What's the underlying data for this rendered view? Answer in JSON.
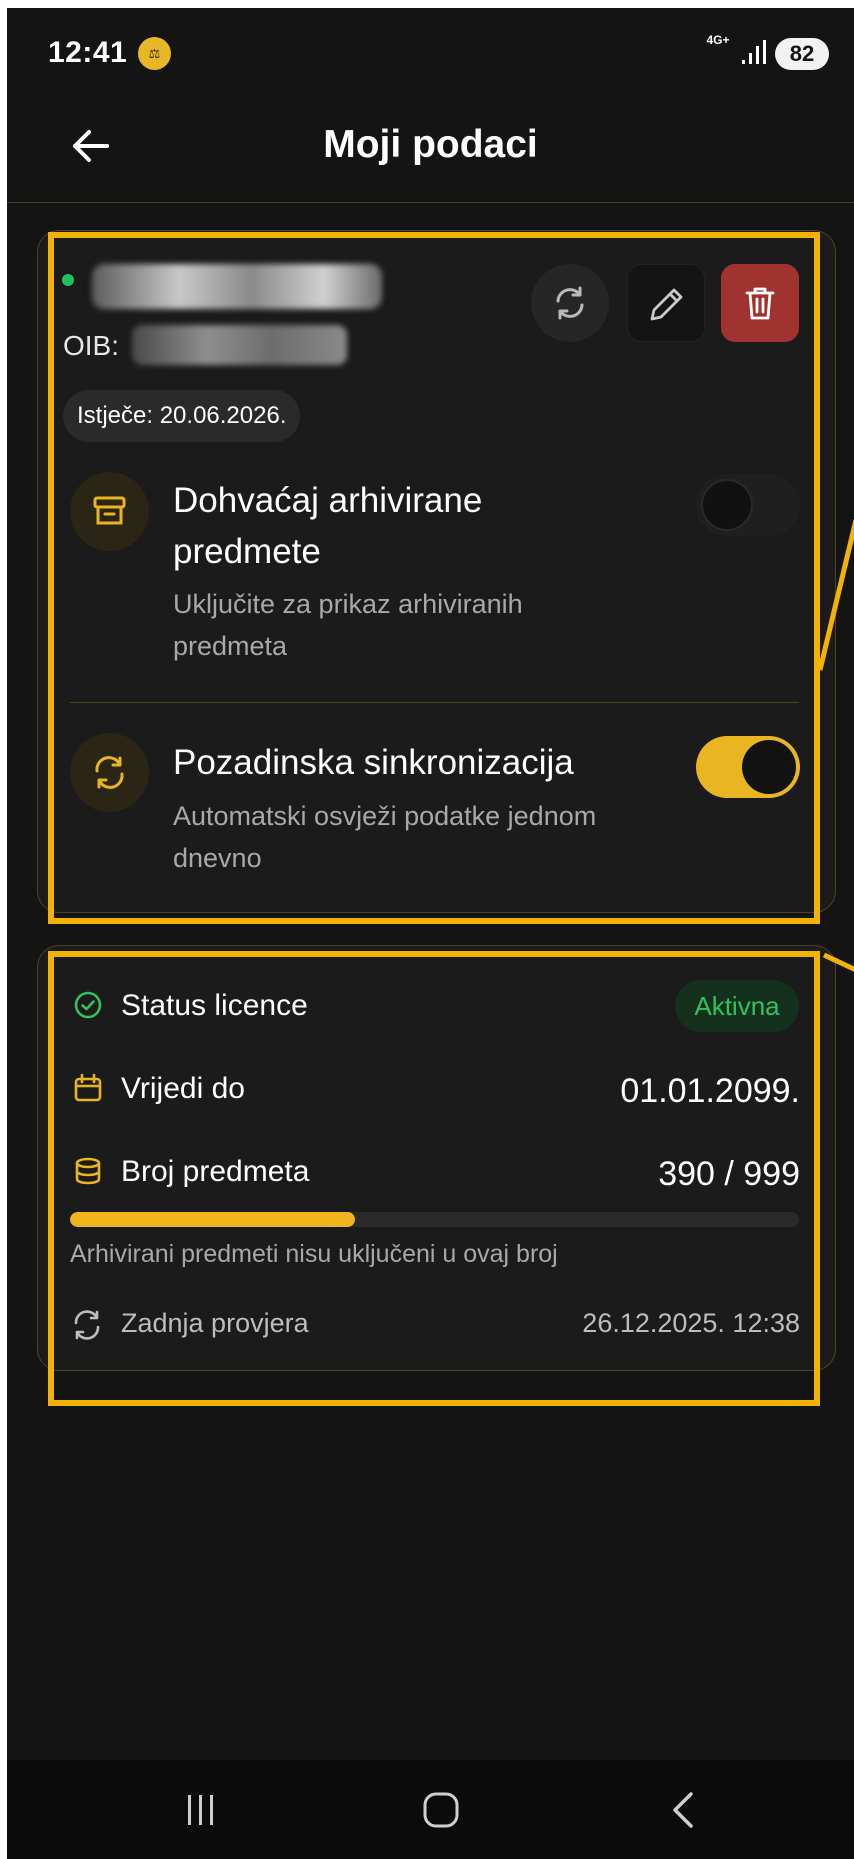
{
  "status_bar": {
    "time": "12:41",
    "network": "4G+",
    "battery": "82",
    "notification_icon": "scales-icon",
    "accent": "#e9b625"
  },
  "header": {
    "title": "Moji podaci",
    "back_icon": "arrow-left-icon"
  },
  "account": {
    "online": true,
    "oib_label": "OIB:",
    "expiry": "Istječe: 20.06.2026.",
    "actions": [
      "refresh",
      "edit",
      "delete"
    ],
    "options": [
      {
        "id": "archive",
        "icon": "archive-box-icon",
        "title": "Dohvaćaj arhivirane predmete",
        "subtitle": "Uključite za prikaz arhiviranih predmeta",
        "enabled": false
      },
      {
        "id": "sync",
        "icon": "sync-icon",
        "title": "Pozadinska sinkronizacija",
        "subtitle": "Automatski osvježi podatke jednom dnevno",
        "enabled": true
      }
    ]
  },
  "license": {
    "status_label": "Status licence",
    "status_badge": "Aktivna",
    "valid_until_label": "Vrijedi do",
    "valid_until_value": "01.01.2099.",
    "cases_label": "Broj predmeta",
    "cases_value": "390 / 999",
    "cases_used": 390,
    "cases_max": 999,
    "note": "Arhivirani predmeti nisu uključeni u ovaj broj",
    "last_check_label": "Zadnja provjera",
    "last_check_value": "26.12.2025. 12:38"
  },
  "colors": {
    "accent": "#f0b41d",
    "success": "#31c15f",
    "danger": "#a0322f",
    "background": "#141414"
  }
}
